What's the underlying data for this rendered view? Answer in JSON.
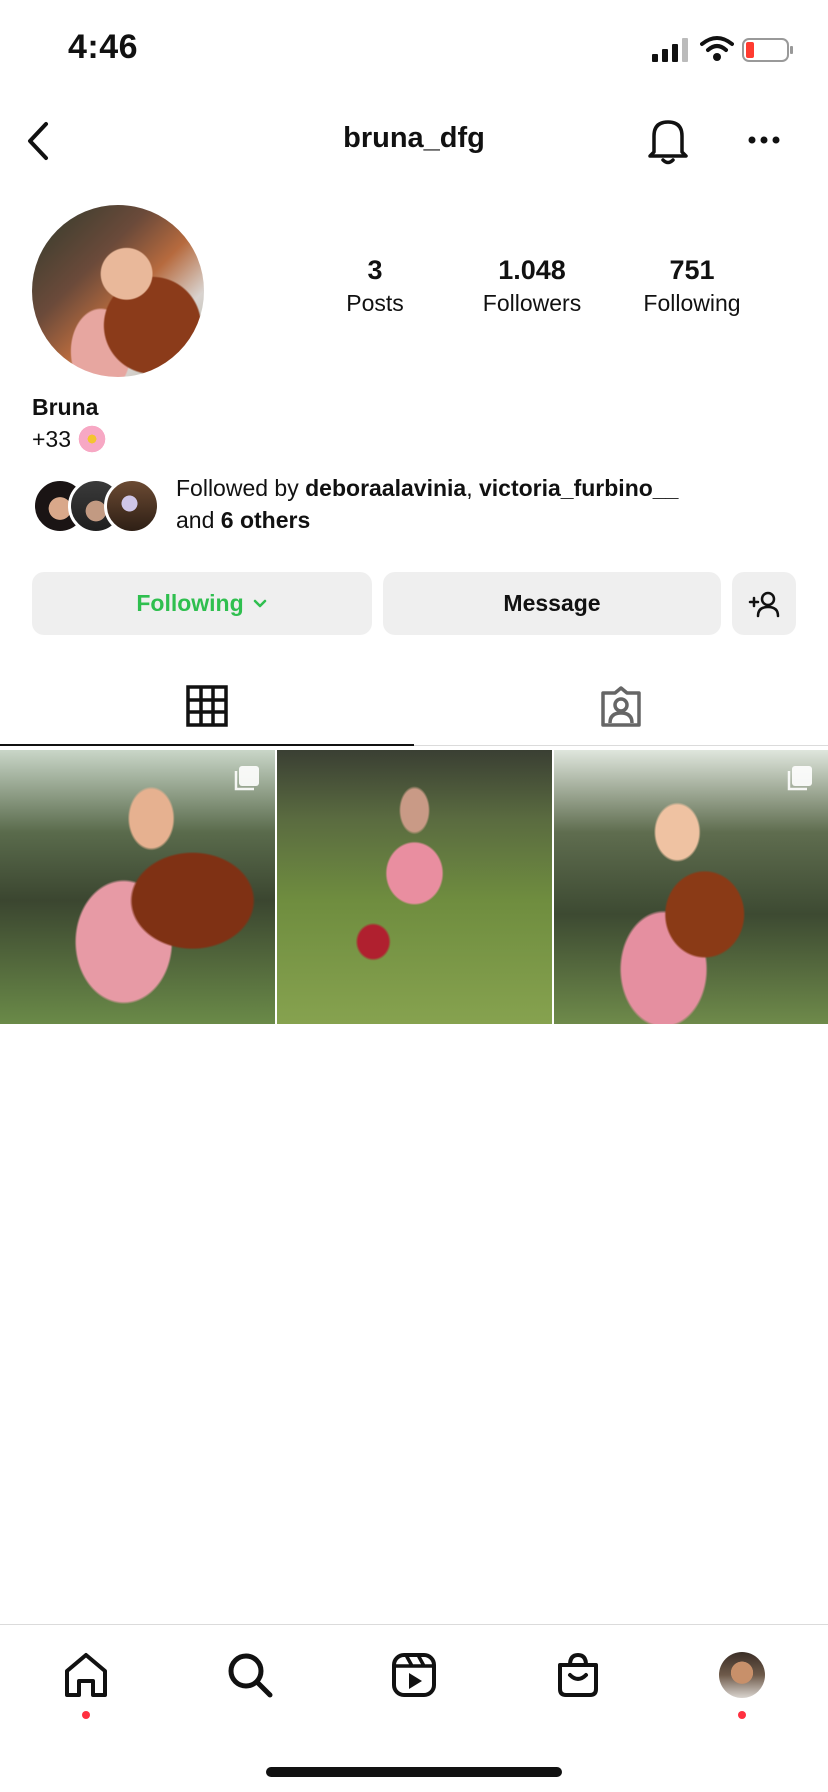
{
  "status_bar": {
    "time": "4:46",
    "signal_icon": "cellular-signal-icon",
    "wifi_icon": "wifi-icon",
    "battery_icon": "battery-low-icon",
    "battery_color": "#ff3b30"
  },
  "header": {
    "username": "bruna_dfg",
    "back_icon": "chevron-left-icon",
    "bell_icon": "bell-icon",
    "more_icon": "more-horizontal-icon"
  },
  "profile": {
    "stats": [
      {
        "value": "3",
        "label": "Posts"
      },
      {
        "value": "1.048",
        "label": "Followers"
      },
      {
        "value": "751",
        "label": "Following"
      }
    ],
    "name": "Bruna",
    "bio": "+33",
    "bio_emoji": "cherry-blossom-icon"
  },
  "followed_by": {
    "prefix": "Followed by",
    "user1": "deboraalavinia",
    "separator": ",",
    "user2": "victoria_furbino__",
    "and": "and",
    "others": "6 others"
  },
  "actions": {
    "following_label": "Following",
    "following_color": "#2fbf4f",
    "message_label": "Message",
    "add_user_icon": "add-user-icon"
  },
  "tabs": [
    {
      "name": "grid",
      "icon": "grid-icon",
      "active": true
    },
    {
      "name": "tagged",
      "icon": "tagged-person-icon",
      "active": false
    }
  ],
  "posts": [
    {
      "type": "carousel"
    },
    {
      "type": "single"
    },
    {
      "type": "carousel"
    }
  ],
  "bottom_nav": [
    {
      "name": "home",
      "icon": "home-icon",
      "has_dot": true
    },
    {
      "name": "search",
      "icon": "search-icon",
      "has_dot": false
    },
    {
      "name": "reels",
      "icon": "reels-icon",
      "has_dot": false
    },
    {
      "name": "shop",
      "icon": "shop-bag-icon",
      "has_dot": false
    },
    {
      "name": "profile",
      "icon": "profile-avatar",
      "has_dot": true
    }
  ],
  "accent_colors": {
    "notification_dot": "#ff3040",
    "divider": "#dbdbdb",
    "button_bg": "#efefef"
  }
}
